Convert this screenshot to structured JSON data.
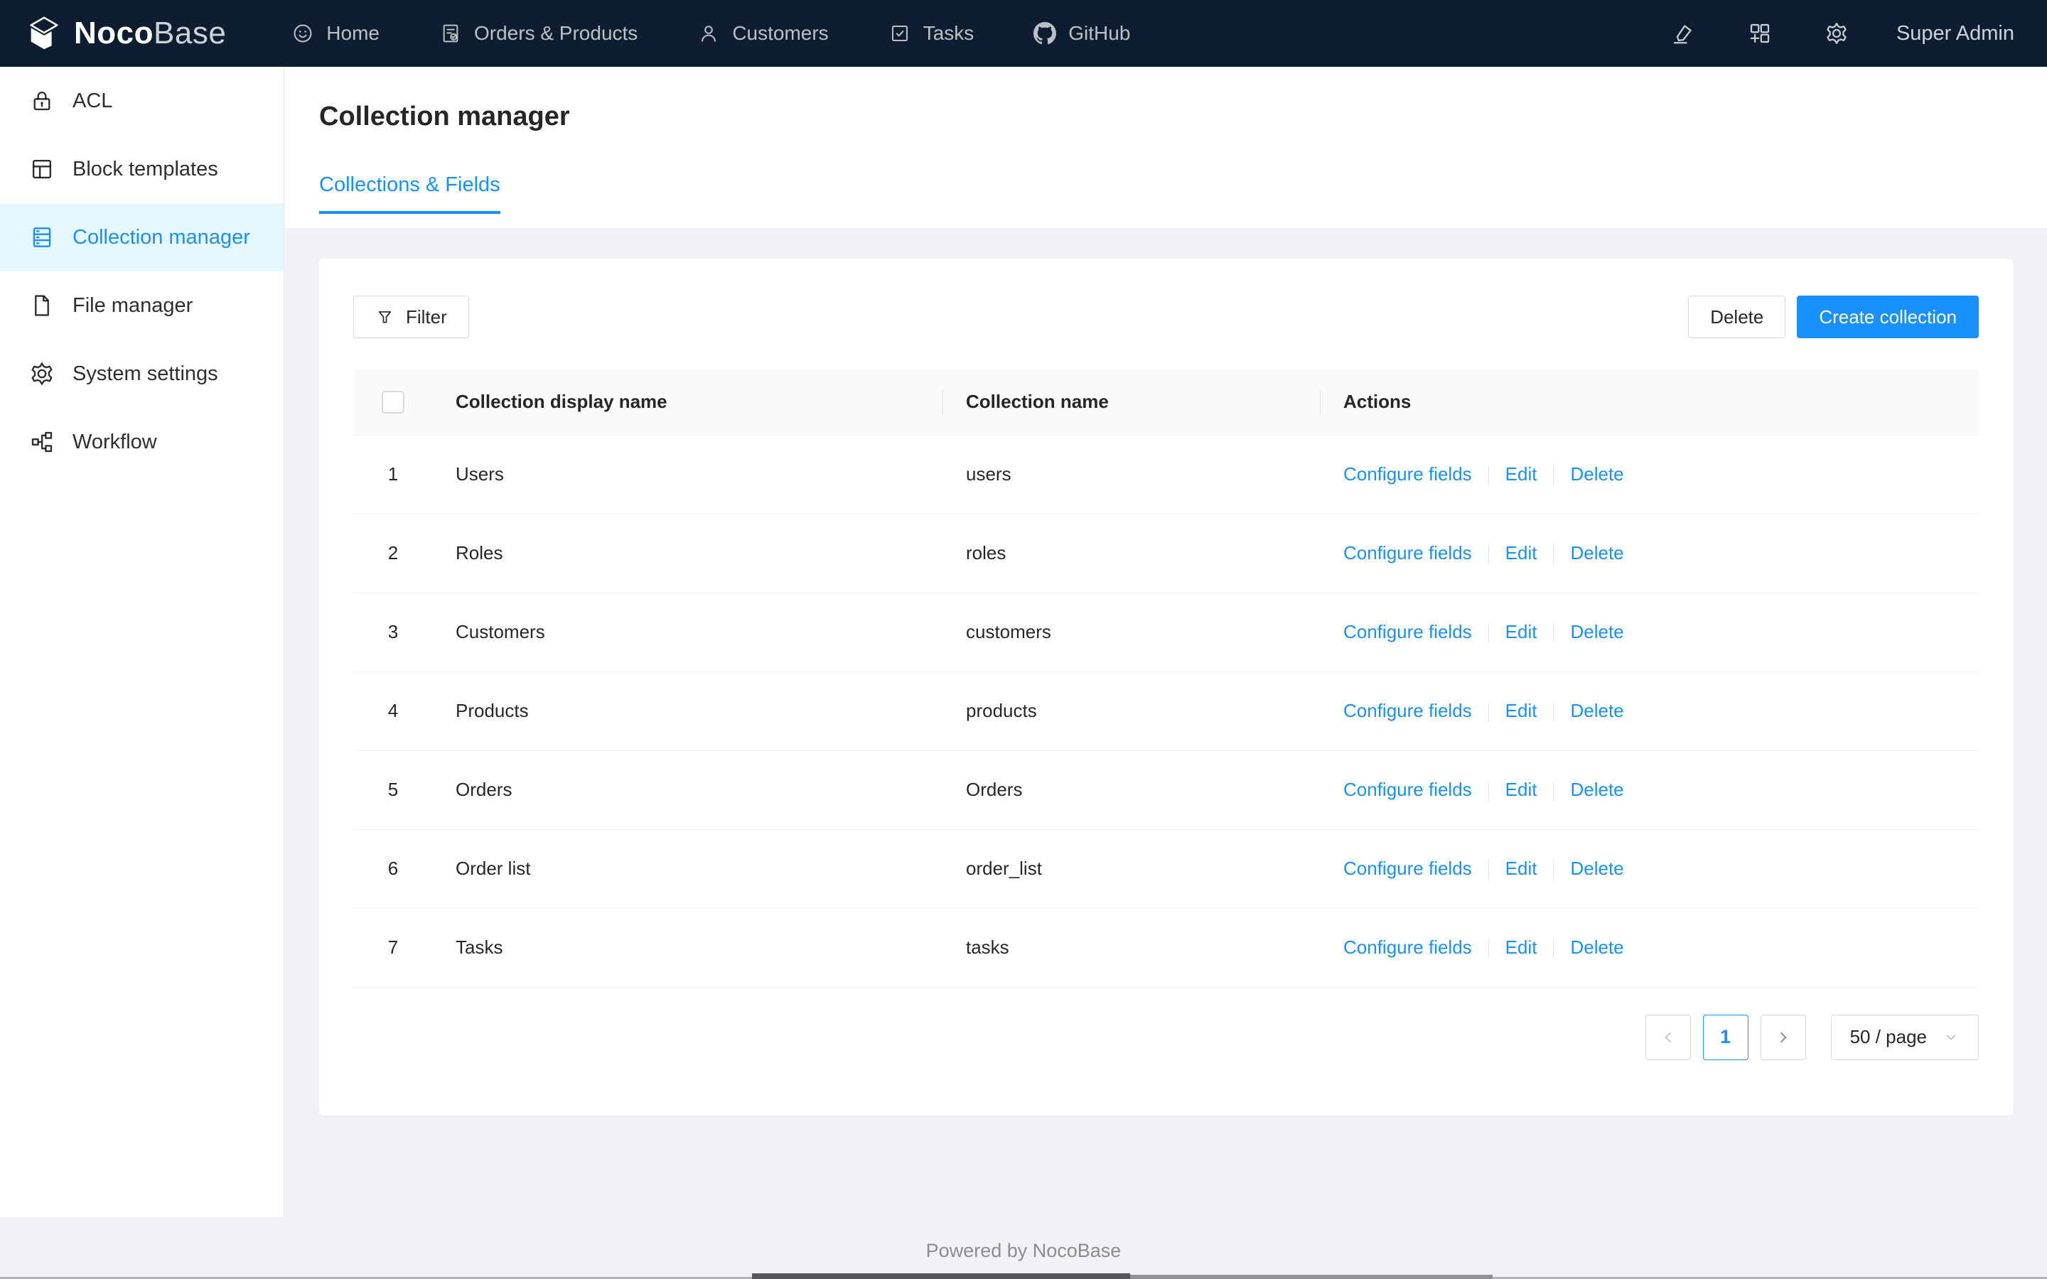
{
  "topbar": {
    "logo": {
      "noco": "Noco",
      "base": "Base",
      "icon": "nocobase-cube-icon"
    },
    "menu": [
      {
        "label": "Home",
        "icon": "smile-icon"
      },
      {
        "label": "Orders & Products",
        "icon": "document-check-icon"
      },
      {
        "label": "Customers",
        "icon": "user-icon"
      },
      {
        "label": "Tasks",
        "icon": "check-square-icon"
      },
      {
        "label": "GitHub",
        "icon": "github-icon"
      }
    ],
    "action_icons": [
      "highlighter-icon",
      "appstore-add-icon",
      "gear-icon"
    ],
    "user": "Super Admin"
  },
  "sidebar": {
    "items": [
      {
        "label": "ACL",
        "icon": "lock-icon",
        "active": false
      },
      {
        "label": "Block templates",
        "icon": "layout-icon",
        "active": false
      },
      {
        "label": "Collection manager",
        "icon": "database-icon",
        "active": true
      },
      {
        "label": "File manager",
        "icon": "file-icon",
        "active": false
      },
      {
        "label": "System settings",
        "icon": "gear-icon",
        "active": false
      },
      {
        "label": "Workflow",
        "icon": "workflow-icon",
        "active": false
      }
    ]
  },
  "page": {
    "title": "Collection manager",
    "tab": "Collections & Fields"
  },
  "toolbar": {
    "filter_label": "Filter",
    "delete_label": "Delete",
    "create_label": "Create collection"
  },
  "table": {
    "columns": [
      "Collection display name",
      "Collection name",
      "Actions"
    ],
    "row_actions": [
      "Configure fields",
      "Edit",
      "Delete"
    ],
    "rows": [
      {
        "index": "1",
        "display_name": "Users",
        "name": "users"
      },
      {
        "index": "2",
        "display_name": "Roles",
        "name": "roles"
      },
      {
        "index": "3",
        "display_name": "Customers",
        "name": "customers"
      },
      {
        "index": "4",
        "display_name": "Products",
        "name": "products"
      },
      {
        "index": "5",
        "display_name": "Orders",
        "name": "Orders"
      },
      {
        "index": "6",
        "display_name": "Order list",
        "name": "order_list"
      },
      {
        "index": "7",
        "display_name": "Tasks",
        "name": "tasks"
      }
    ]
  },
  "pagination": {
    "current": "1",
    "page_size": "50 / page"
  },
  "footer": {
    "text": "Powered by NocoBase"
  },
  "colors": {
    "primary": "#1890ff",
    "topbar_bg": "#0e1e30",
    "content_bg": "#f0f2f5",
    "selected_bg": "#e6f7ff",
    "table_border": "#f0f0f0",
    "table_header_bg": "#fafafa"
  }
}
